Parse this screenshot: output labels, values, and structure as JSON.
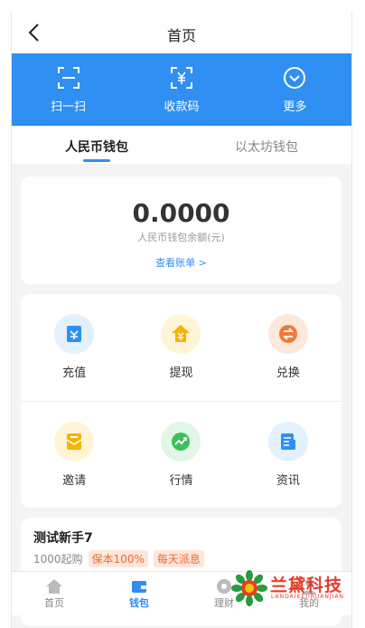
{
  "header": {
    "title": "首页"
  },
  "actions": [
    {
      "label": "扫一扫",
      "icon": "scan-icon"
    },
    {
      "label": "收款码",
      "icon": "yuan-qr-icon"
    },
    {
      "label": "更多",
      "icon": "chevron-circle-icon"
    }
  ],
  "tabs": [
    {
      "label": "人民币钱包",
      "active": true
    },
    {
      "label": "以太坊钱包",
      "active": false
    }
  ],
  "balance": {
    "amount": "0.0000",
    "caption": "人民币钱包余额(元)",
    "link": "查看账单 >"
  },
  "grid": [
    {
      "label": "充值",
      "icon": "recharge-icon",
      "color": "#2f8ff2"
    },
    {
      "label": "提现",
      "icon": "withdraw-icon",
      "color": "#f5b400"
    },
    {
      "label": "兑换",
      "icon": "exchange-icon",
      "color": "#f07a3a"
    },
    {
      "label": "邀请",
      "icon": "invite-icon",
      "color": "#f5b400"
    },
    {
      "label": "行情",
      "icon": "market-icon",
      "color": "#3cc05c"
    },
    {
      "label": "资讯",
      "icon": "news-icon",
      "color": "#2f8ff2"
    }
  ],
  "product": {
    "name": "测试新手7",
    "min": "1000起购",
    "badges": [
      "保本100%",
      "每天派息"
    ]
  },
  "nav": [
    {
      "label": "首页",
      "icon": "home-icon",
      "active": false
    },
    {
      "label": "钱包",
      "icon": "wallet-icon",
      "active": true
    },
    {
      "label": "理财",
      "icon": "finance-icon",
      "active": false
    },
    {
      "label": "我的",
      "icon": "user-icon",
      "active": false
    }
  ],
  "watermark": {
    "text": "兰黛科技",
    "sub": "LANDAIKEJIRUANJIAN"
  },
  "colors": {
    "primary": "#2f8ff2",
    "accent": "#f06a2a"
  }
}
